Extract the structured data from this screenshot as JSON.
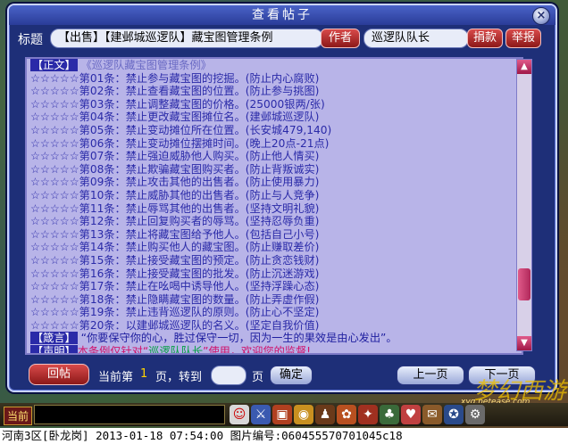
{
  "window": {
    "title": "查看帖子",
    "close_label": "×"
  },
  "post": {
    "title_label": "标题",
    "title": "【出售】【建邺城巡逻队】藏宝图管理条例",
    "author_button": "作者",
    "author": "巡逻队队长",
    "donate_button": "捐款",
    "report_button": "举报"
  },
  "content": {
    "header_tag": "【正文】",
    "header_text": "《巡逻队藏宝图管理条例》",
    "rules": [
      "☆☆☆☆☆第01条：禁止参与藏宝图的挖掘。(防止内心腐败)",
      "☆☆☆☆☆第02条：禁止查看藏宝图的位置。(防止参与挑图)",
      "☆☆☆☆☆第03条：禁止调整藏宝图的价格。(25000银两/张)",
      "☆☆☆☆☆第04条：禁止更改藏宝图摊位名。(建邺城巡逻队)",
      "☆☆☆☆☆第05条：禁止变动摊位所在位置。(长安城479,140)",
      "☆☆☆☆☆第06条：禁止变动摊位摆摊时间。(晚上20点-21点)",
      "☆☆☆☆☆第07条：禁止强迫威胁他人购买。(防止他人情买)",
      "☆☆☆☆☆第08条：禁止欺骗藏宝图购买者。(防止背叛诚实)",
      "☆☆☆☆☆第09条：禁止攻击其他的出售者。(防止使用暴力)",
      "☆☆☆☆☆第10条：禁止威胁其他的出售者。(防止与人竞争)",
      "☆☆☆☆☆第11条：禁止辱骂其他的出售者。(坚持文明礼貌)",
      "☆☆☆☆☆第12条：禁止回复购买者的辱骂。(坚持忍辱负重)",
      "☆☆☆☆☆第13条：禁止将藏宝图给予他人。(包括自己小号)",
      "☆☆☆☆☆第14条：禁止购买他人的藏宝图。(防止赚取差价)",
      "☆☆☆☆☆第15条：禁止接受藏宝图的预定。(防止贪恋钱财)",
      "☆☆☆☆☆第16条：禁止接受藏宝图的批发。(防止沉迷游戏)",
      "☆☆☆☆☆第17条：禁止在吆喝中诱导他人。(坚持浮躁心态)",
      "☆☆☆☆☆第18条：禁止隐瞒藏宝图的数量。(防止弄虚作假)",
      "☆☆☆☆☆第19条：禁止违背巡逻队的原则。(防止心不坚定)",
      "☆☆☆☆☆第20条：以建邺城巡逻队的名义。(坚定自我价值)"
    ],
    "motto_tag": "【箴言】",
    "motto": "“你要保守你的心，胜过保守一切，因为一生的果效是由心发出”。",
    "decl_tag": "【声明】",
    "decl_pre": "本条例仅针对“",
    "decl_team": "巡逻队队长",
    "decl_post": "”使用，欢迎您的监督!"
  },
  "footer": {
    "reply_button": "回帖",
    "current_page_pre": "当前第",
    "current_page": "1",
    "page_goto": "页，转到",
    "page_suffix": "页",
    "confirm_button": "确定",
    "prev_button": "上一页",
    "next_button": "下一页"
  },
  "hud": {
    "channel_label": "当前"
  },
  "watermark": {
    "text": "梦幻西游",
    "site": "xyq.netease.com"
  },
  "status_bar": "河南3区[卧龙岗] 2013-01-18 07:54:00 图片编号:060455570701045c18"
}
